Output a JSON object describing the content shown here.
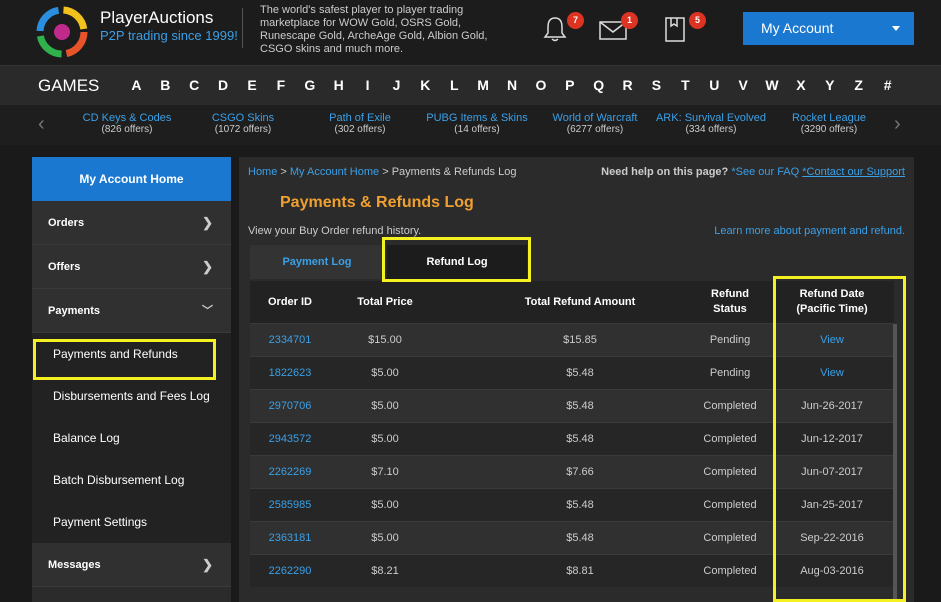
{
  "brand": {
    "name": "PlayerAuctions",
    "tag_prefix": "P2P trading ",
    "tag_year": "since 1999!",
    "tagline": "The world's safest player to player trading marketplace for WOW Gold, OSRS Gold, Runescape Gold, ArcheAge Gold, Albion Gold, CSGO skins and much more."
  },
  "header": {
    "notifications_count": "7",
    "messages_count": "1",
    "orders_count": "5",
    "my_account_label": "My Account"
  },
  "games_bar": {
    "label": "GAMES",
    "letters": [
      "A",
      "B",
      "C",
      "D",
      "E",
      "F",
      "G",
      "H",
      "I",
      "J",
      "K",
      "L",
      "M",
      "N",
      "O",
      "P",
      "Q",
      "R",
      "S",
      "T",
      "U",
      "V",
      "W",
      "X",
      "Y",
      "Z",
      "#"
    ]
  },
  "categories": [
    {
      "name": "CD Keys & Codes",
      "count": "(826 offers)"
    },
    {
      "name": "CSGO Skins",
      "count": "(1072 offers)"
    },
    {
      "name": "Path of Exile",
      "count": "(302 offers)"
    },
    {
      "name": "PUBG Items & Skins",
      "count": "(14 offers)"
    },
    {
      "name": "World of Warcraft",
      "count": "(6277 offers)"
    },
    {
      "name": "ARK: Survival Evolved",
      "count": "(334 offers)"
    },
    {
      "name": "Rocket League",
      "count": "(3290 offers)"
    }
  ],
  "sidebar": {
    "home": "My Account Home",
    "orders": "Orders",
    "offers": "Offers",
    "payments": "Payments",
    "sub_items": [
      "Payments and Refunds",
      "Disbursements and Fees Log",
      "Balance Log",
      "Batch Disbursement Log",
      "Payment Settings"
    ],
    "messages": "Messages"
  },
  "main": {
    "crumb_home": "Home",
    "crumb_sep": " > ",
    "crumb_account": "My Account Home",
    "crumb_current": "Payments & Refunds Log",
    "help_q": "Need help on this page?",
    "help_faq": "*See our FAQ",
    "help_contact": "*Contact our Support",
    "title": "Payments & Refunds Log",
    "description": "View your Buy Order refund history.",
    "learn_more": "Learn more about payment and refund.",
    "tab_payment": "Payment Log",
    "tab_refund": "Refund Log"
  },
  "table": {
    "headers": {
      "order_id": "Order ID",
      "total_price": "Total Price",
      "total_refund": "Total Refund Amount",
      "refund_status_1": "Refund",
      "refund_status_2": "Status",
      "refund_date_1": "Refund Date",
      "refund_date_2": "(Pacific Time)"
    },
    "rows": [
      {
        "id": "2334701",
        "price": "$15.00",
        "refund": "$15.85",
        "status": "Pending",
        "date": "View"
      },
      {
        "id": "1822623",
        "price": "$5.00",
        "refund": "$5.48",
        "status": "Pending",
        "date": "View"
      },
      {
        "id": "2970706",
        "price": "$5.00",
        "refund": "$5.48",
        "status": "Completed",
        "date": "Jun-26-2017"
      },
      {
        "id": "2943572",
        "price": "$5.00",
        "refund": "$5.48",
        "status": "Completed",
        "date": "Jun-12-2017"
      },
      {
        "id": "2262269",
        "price": "$7.10",
        "refund": "$7.66",
        "status": "Completed",
        "date": "Jun-07-2017"
      },
      {
        "id": "2585985",
        "price": "$5.00",
        "refund": "$5.48",
        "status": "Completed",
        "date": "Jan-25-2017"
      },
      {
        "id": "2363181",
        "price": "$5.00",
        "refund": "$5.48",
        "status": "Completed",
        "date": "Sep-22-2016"
      },
      {
        "id": "2262290",
        "price": "$8.21",
        "refund": "$8.81",
        "status": "Completed",
        "date": "Aug-03-2016"
      }
    ]
  }
}
